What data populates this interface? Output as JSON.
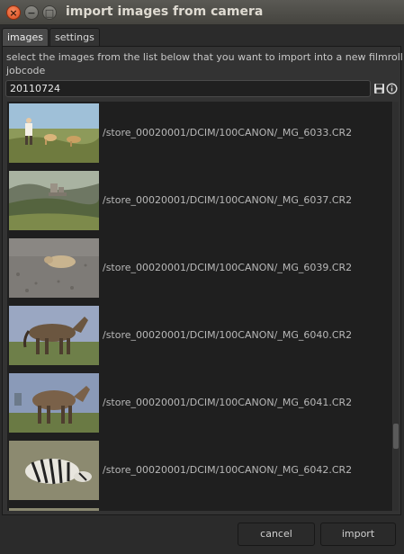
{
  "window": {
    "title": "import images from camera",
    "close_glyph": "×",
    "min_glyph": "−",
    "max_glyph": "□"
  },
  "tabs": [
    {
      "label": "images",
      "active": true
    },
    {
      "label": "settings",
      "active": false
    }
  ],
  "instructions": "select the images from the list below that you want to import into a new filmroll",
  "jobcode": {
    "label": "jobcode",
    "value": "20110724"
  },
  "icons": {
    "save": "save-icon",
    "info": "info-icon"
  },
  "images": [
    {
      "path": "/store_00020001/DCIM/100CANON/_MG_6033.CR2",
      "thumb": "person-with-dogs"
    },
    {
      "path": "/store_00020001/DCIM/100CANON/_MG_6037.CR2",
      "thumb": "castle-landscape"
    },
    {
      "path": "/store_00020001/DCIM/100CANON/_MG_6039.CR2",
      "thumb": "animal-on-gravel"
    },
    {
      "path": "/store_00020001/DCIM/100CANON/_MG_6040.CR2",
      "thumb": "horse"
    },
    {
      "path": "/store_00020001/DCIM/100CANON/_MG_6041.CR2",
      "thumb": "horse"
    },
    {
      "path": "/store_00020001/DCIM/100CANON/_MG_6042.CR2",
      "thumb": "zebra"
    }
  ],
  "buttons": {
    "cancel": "cancel",
    "import": "import"
  },
  "colors": {
    "titlebar": "#45443f",
    "close_button": "#d9491c",
    "panel_bg": "#333333",
    "list_bg": "#1f1f1f"
  }
}
